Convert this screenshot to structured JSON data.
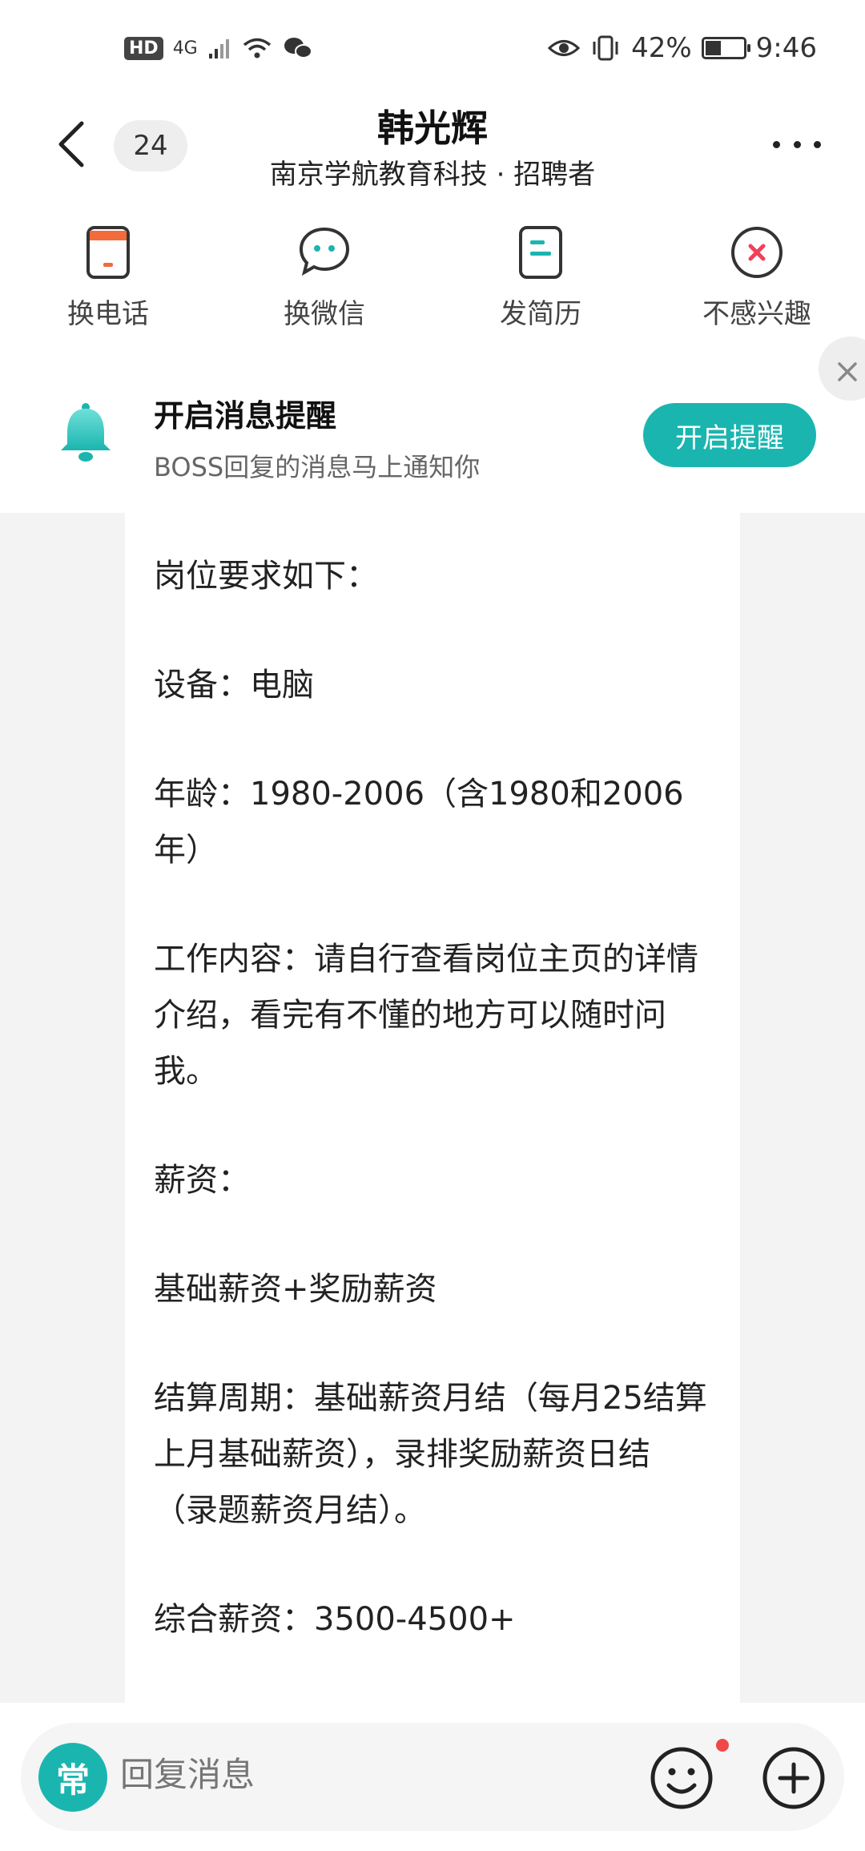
{
  "status_bar": {
    "hd": "HD",
    "network": "4G",
    "battery": "42%",
    "battery_level": 0.42,
    "time": "9:46"
  },
  "header": {
    "back_icon": "chevron-left-icon",
    "unread_count": "24",
    "title": "韩光辉",
    "subtitle": "南京学航教育科技 · 招聘者",
    "more_icon": "more-dots-icon"
  },
  "actions": [
    {
      "label": "换电话",
      "icon": "phone-icon",
      "color": "#f26b3a"
    },
    {
      "label": "换微信",
      "icon": "wechat-icon",
      "color": "#1bb5b0"
    },
    {
      "label": "发简历",
      "icon": "resume-icon",
      "color": "#1bb5b0"
    },
    {
      "label": "不感兴趣",
      "icon": "not-interested-icon",
      "color": "#f0415a"
    }
  ],
  "notice": {
    "title": "开启消息提醒",
    "subtitle": "BOSS回复的消息马上通知你",
    "button": "开启提醒",
    "bell_icon": "bell-icon",
    "close_icon": "close-icon"
  },
  "message": {
    "paragraphs": [
      "岗位要求如下：",
      "设备：电脑",
      "年龄：1980-2006（含1980和2006年）",
      "工作内容：请自行查看岗位主页的详情介绍，看完有不懂的地方可以随时问我。",
      "薪资：",
      "基础薪资+奖励薪资",
      "结算周期：基础薪资月结（每月25结算上月基础薪资），录排奖励薪资日结（录题薪资月结）。",
      "综合薪资：3500-4500+"
    ]
  },
  "input_bar": {
    "quick_label": "常",
    "placeholder": "回复消息",
    "emoji_icon": "emoji-icon",
    "plus_icon": "plus-icon"
  },
  "colors": {
    "accent": "#1bb5b0",
    "background": "#f3f3f3"
  }
}
